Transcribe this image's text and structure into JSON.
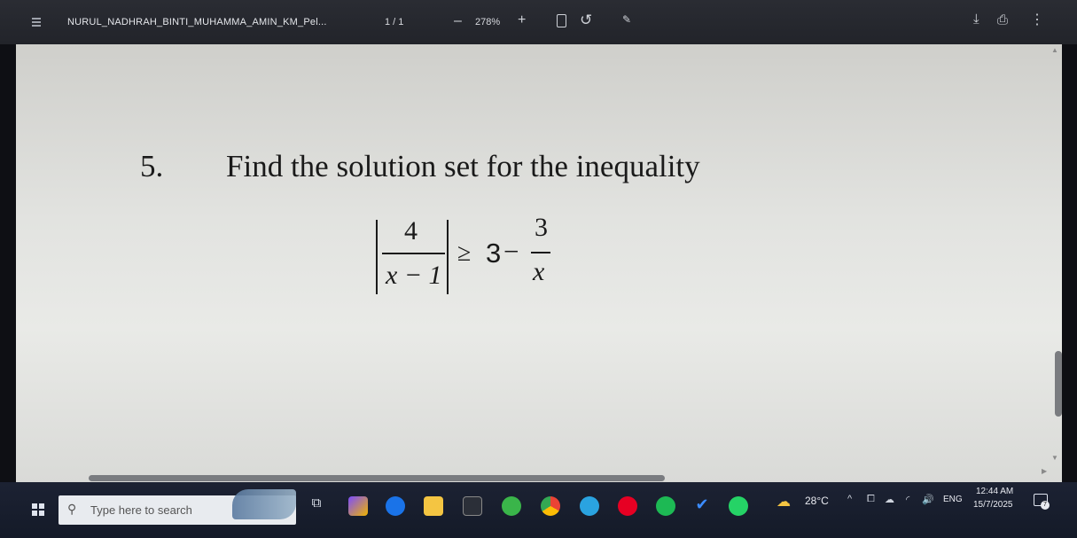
{
  "toolbar": {
    "title": "NURUL_NADHRAH_BINTI_MUHAMMA_AMIN_KM_Pel...",
    "page": "1 / 1",
    "zoom_minus": "–",
    "zoom": "278%",
    "zoom_plus": "+",
    "icons": [
      "menu-icon",
      "fit-page-icon",
      "rotate-icon",
      "draw-icon",
      "download-icon",
      "print-icon",
      "more-icon"
    ]
  },
  "document": {
    "question_number": "5.",
    "question_text": "Find the solution set for the inequality",
    "math": {
      "numerator": "4",
      "denominator": "x − 1",
      "relation": "≥",
      "rhs_whole": "3",
      "rhs_minus": "−",
      "rhs_numerator": "3",
      "rhs_denominator": "x"
    }
  },
  "taskbar": {
    "search_placeholder": "Type here to search",
    "temperature": "28°C",
    "language": "ENG",
    "time": "12:44 AM",
    "date": "15/7/2025",
    "notification_count": "7",
    "tray_up": "^",
    "tray_sound": "🔊"
  }
}
